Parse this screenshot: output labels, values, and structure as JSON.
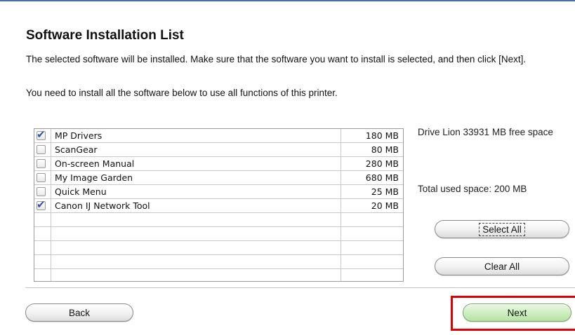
{
  "header": {
    "title": "Software Installation List",
    "description": "The selected software will be installed. Make sure that the software you want to install is selected, and then click [Next].",
    "note": "You need to install all the software below to use all functions of this printer."
  },
  "software_list": {
    "items": [
      {
        "name": "MP Drivers",
        "size": "180 MB",
        "checked": true
      },
      {
        "name": "ScanGear",
        "size": "80 MB",
        "checked": false
      },
      {
        "name": "On-screen Manual",
        "size": "280 MB",
        "checked": false
      },
      {
        "name": "My Image Garden",
        "size": "680 MB",
        "checked": false
      },
      {
        "name": "Quick Menu",
        "size": "25 MB",
        "checked": false
      },
      {
        "name": "Canon IJ Network Tool",
        "size": "20 MB",
        "checked": true
      }
    ],
    "empty_rows": 5
  },
  "side": {
    "free_space": "Drive Lion 33931 MB free space",
    "used_space": "Total used space: 200 MB",
    "select_all_label": "Select All",
    "clear_all_label": "Clear All"
  },
  "footer": {
    "back_label": "Back",
    "next_label": "Next"
  },
  "colors": {
    "highlight": "#e00000",
    "next_button": "#cdeebf"
  },
  "icons": {
    "checkbox_checked": "check-icon"
  }
}
